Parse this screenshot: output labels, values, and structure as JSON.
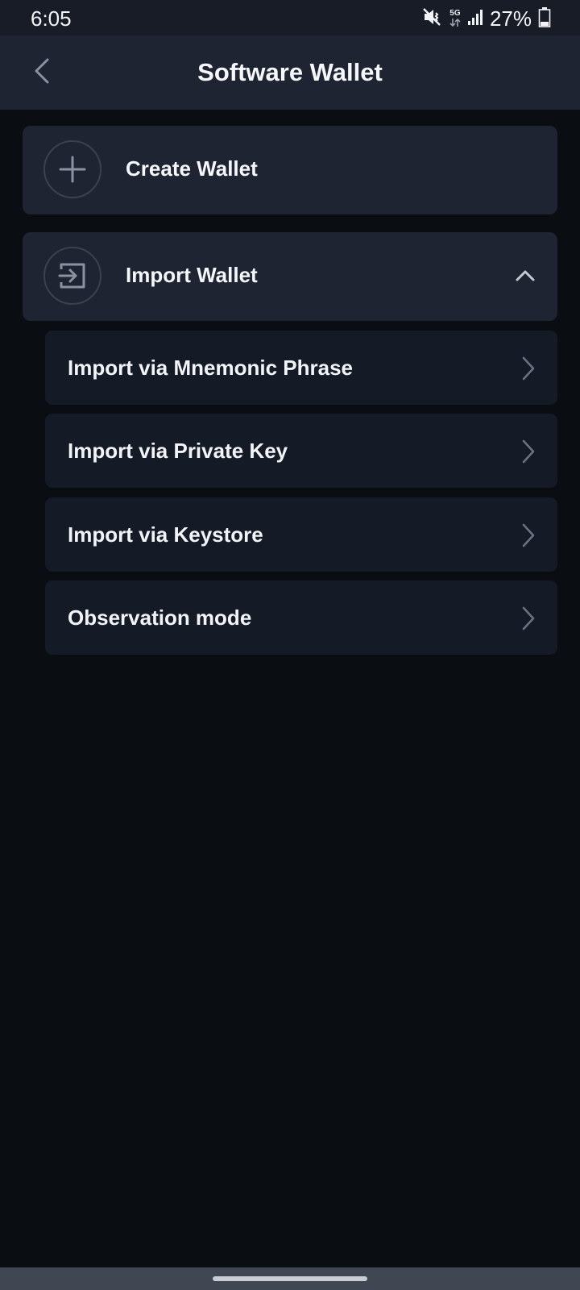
{
  "status_bar": {
    "time": "6:05",
    "network": "5G",
    "battery": "27%",
    "icons": [
      "mute-icon",
      "network-5g-icon",
      "signal-icon",
      "battery-icon"
    ]
  },
  "header": {
    "title": "Software Wallet",
    "back_icon": "chevron-left-icon"
  },
  "main": {
    "create": {
      "label": "Create Wallet",
      "icon": "plus-icon"
    },
    "import": {
      "label": "Import Wallet",
      "icon": "import-icon",
      "expanded": true,
      "options": [
        {
          "label": "Import via Mnemonic Phrase"
        },
        {
          "label": "Import via Private Key"
        },
        {
          "label": "Import via Keystore"
        },
        {
          "label": "Observation mode"
        }
      ]
    }
  },
  "colors": {
    "background": "#0a0d12",
    "card": "#1e2431",
    "sub_card": "#141a26",
    "icon_stroke": "#8a92a2"
  }
}
